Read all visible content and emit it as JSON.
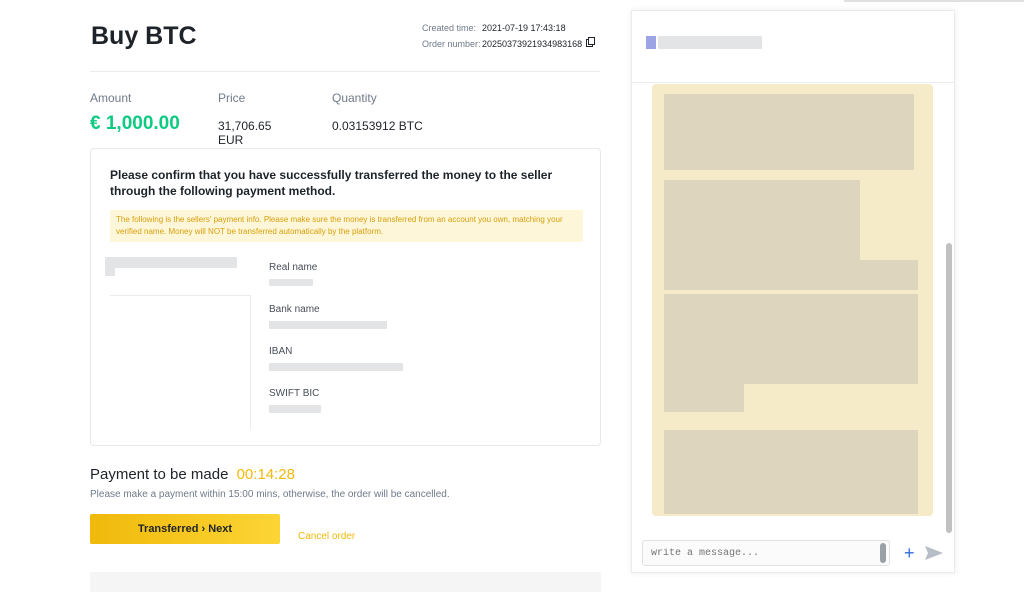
{
  "page": {
    "title": "Buy BTC",
    "created_time_label": "Created time:",
    "created_time": "2021-07-19 17:43:18",
    "order_number_label": "Order number:",
    "order_number": "20250373921934983168"
  },
  "stats": {
    "amount_label": "Amount",
    "amount": "€ 1,000.00",
    "price_label": "Price",
    "price": "31,706.65 EUR",
    "quantity_label": "Quantity",
    "quantity": "0.03153912 BTC"
  },
  "confirm": {
    "message": "Please confirm that you have successfully transferred the money to the seller through the following payment method.",
    "notice": "The following is the sellers' payment info. Please make sure the money is transferred from an account you own, matching your verified name. Money will NOT be transferred automatically by the platform.",
    "fields": [
      {
        "label": "Real name"
      },
      {
        "label": "Bank name"
      },
      {
        "label": "IBAN"
      },
      {
        "label": "SWIFT BIC"
      }
    ]
  },
  "payment": {
    "heading": "Payment to be made",
    "timer": "00:14:28",
    "subtext": "Please make a payment within 15:00 mins, otherwise, the order will be cancelled.",
    "transferred_button": "Transferred › Next",
    "cancel_link": "Cancel order"
  },
  "chat": {
    "input_placeholder": "write a message...",
    "plus_icon": "plus-icon",
    "send_icon": "send-icon"
  },
  "colors": {
    "accent": "#f0b90b",
    "green": "#0ecb81",
    "notice_bg": "#fef6d8",
    "chat_bubble": "#f5ebc8"
  }
}
